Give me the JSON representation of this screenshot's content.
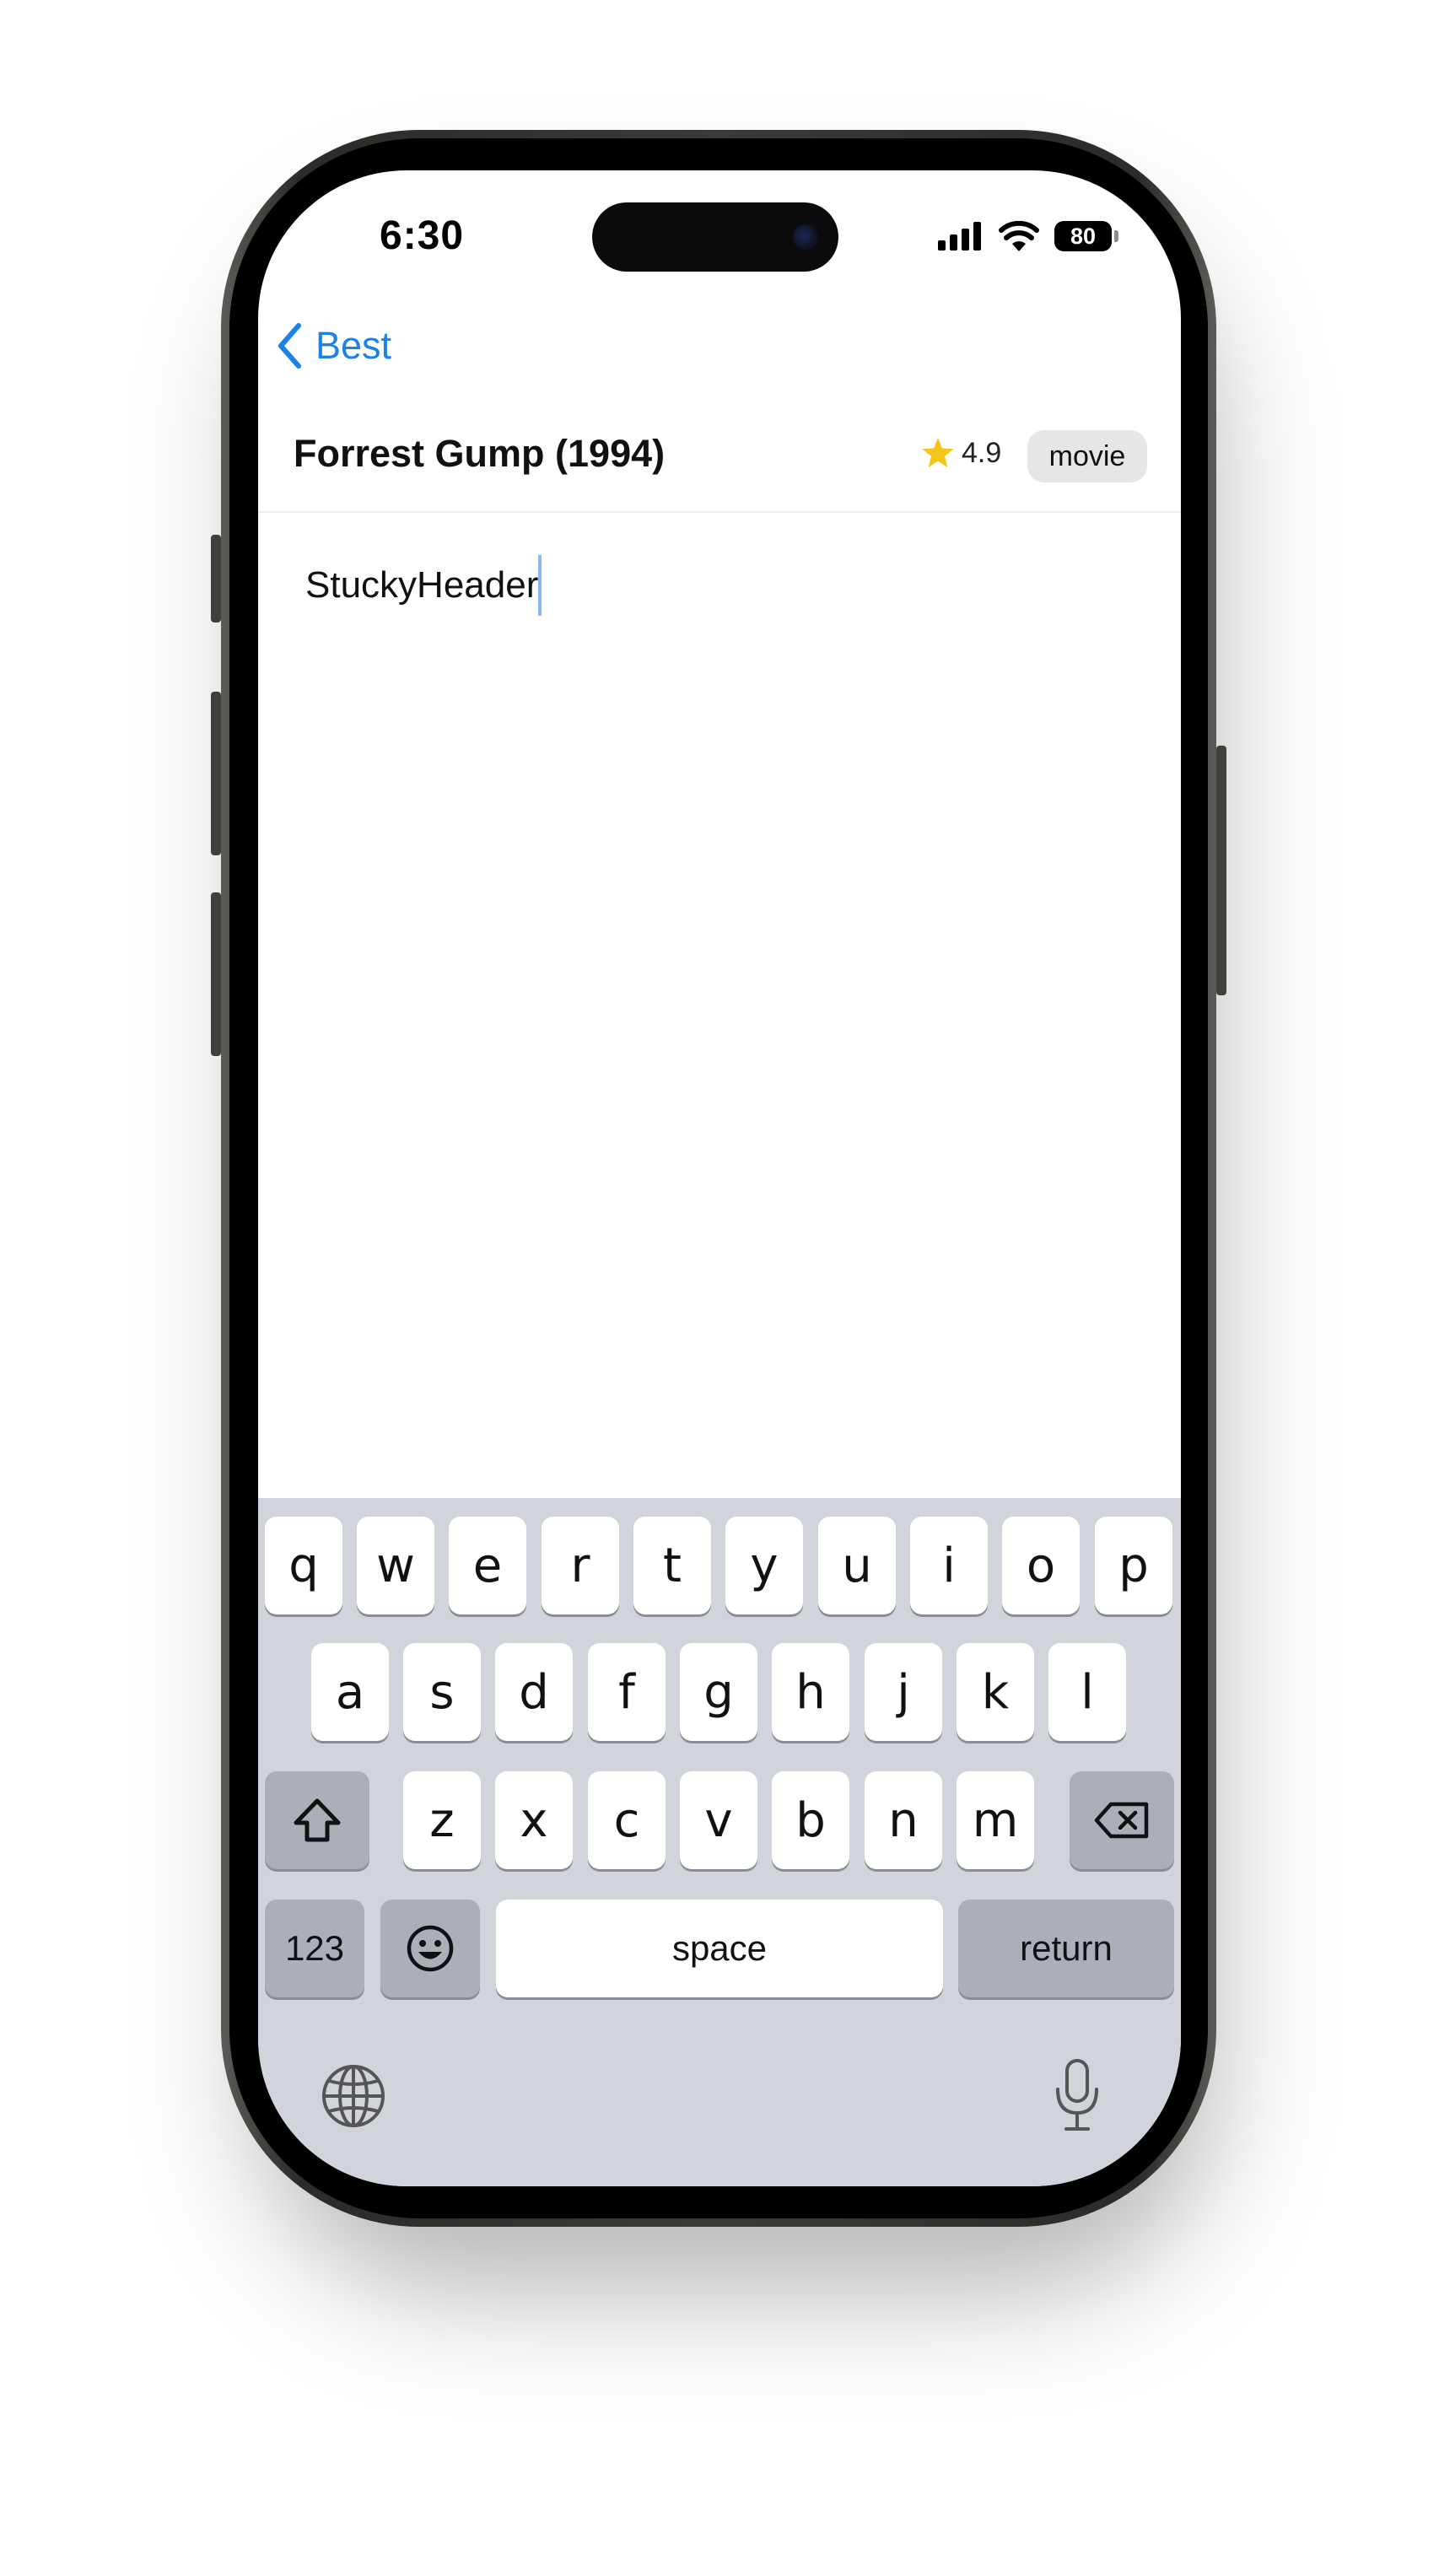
{
  "status_bar": {
    "time": "6:30",
    "battery": "80"
  },
  "nav": {
    "back_label": "Best"
  },
  "header": {
    "title": "Forrest Gump (1994)",
    "rating": "4.9",
    "badge": "movie"
  },
  "editor": {
    "text": "StuckyHeader"
  },
  "keyboard": {
    "row1": [
      "q",
      "w",
      "e",
      "r",
      "t",
      "y",
      "u",
      "i",
      "o",
      "p"
    ],
    "row2": [
      "a",
      "s",
      "d",
      "f",
      "g",
      "h",
      "j",
      "k",
      "l"
    ],
    "row3": [
      "z",
      "x",
      "c",
      "v",
      "b",
      "n",
      "m"
    ],
    "numbers_label": "123",
    "space_label": "space",
    "return_label": "return"
  },
  "icons": [
    "signal-icon",
    "wifi-icon",
    "battery-icon",
    "back-chevron-icon",
    "star-icon",
    "shift-icon",
    "delete-icon",
    "emoji-icon",
    "globe-icon",
    "microphone-icon"
  ],
  "colors": {
    "accent": "#1b82e6",
    "star": "#f5c518",
    "keyboard_bg": "#d1d4db",
    "caret": "#8ab6f2"
  }
}
